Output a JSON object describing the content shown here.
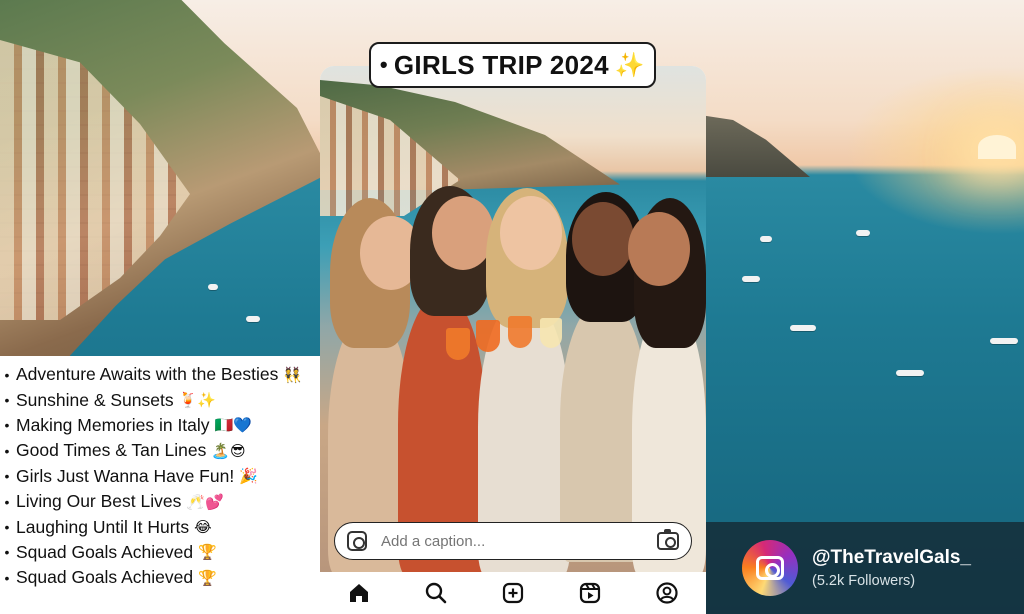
{
  "post": {
    "title": "GIRLS TRIP 2024",
    "title_bullet": "•",
    "title_sparkle": "✨",
    "caption_placeholder": "Add a caption..."
  },
  "list": {
    "bullet": "•",
    "items": [
      {
        "text": "Adventure Awaits with the Besties",
        "emoji": "👯"
      },
      {
        "text": "Sunshine & Sunsets",
        "emoji": "🍹✨"
      },
      {
        "text": "Making Memories in Italy",
        "emoji": "🇮🇹💙"
      },
      {
        "text": "Good Times & Tan Lines",
        "emoji": "🏝️😎"
      },
      {
        "text": "Girls Just Wanna Have Fun!",
        "emoji": "🎉"
      },
      {
        "text": "Living Our Best Lives",
        "emoji": "🥂💕"
      },
      {
        "text": "Laughing Until It Hurts",
        "emoji": "😂"
      },
      {
        "text": "Squad Goals Achieved",
        "emoji": "🏆"
      },
      {
        "text": "Squad Goals Achieved",
        "emoji": "🏆"
      }
    ]
  },
  "profile": {
    "handle": "@TheTravelGals_",
    "followers": "(5.2k Followers)"
  },
  "nav": {
    "items": [
      "home-icon",
      "search-icon",
      "add-post-icon",
      "reels-icon",
      "profile-icon"
    ]
  },
  "colors": {
    "sea": "#1e7a93",
    "sky": "#f4dcc6",
    "instagram_gradient": [
      "#feda75",
      "#fa7e1e",
      "#d62976",
      "#962fbf",
      "#4f5bd5"
    ]
  }
}
